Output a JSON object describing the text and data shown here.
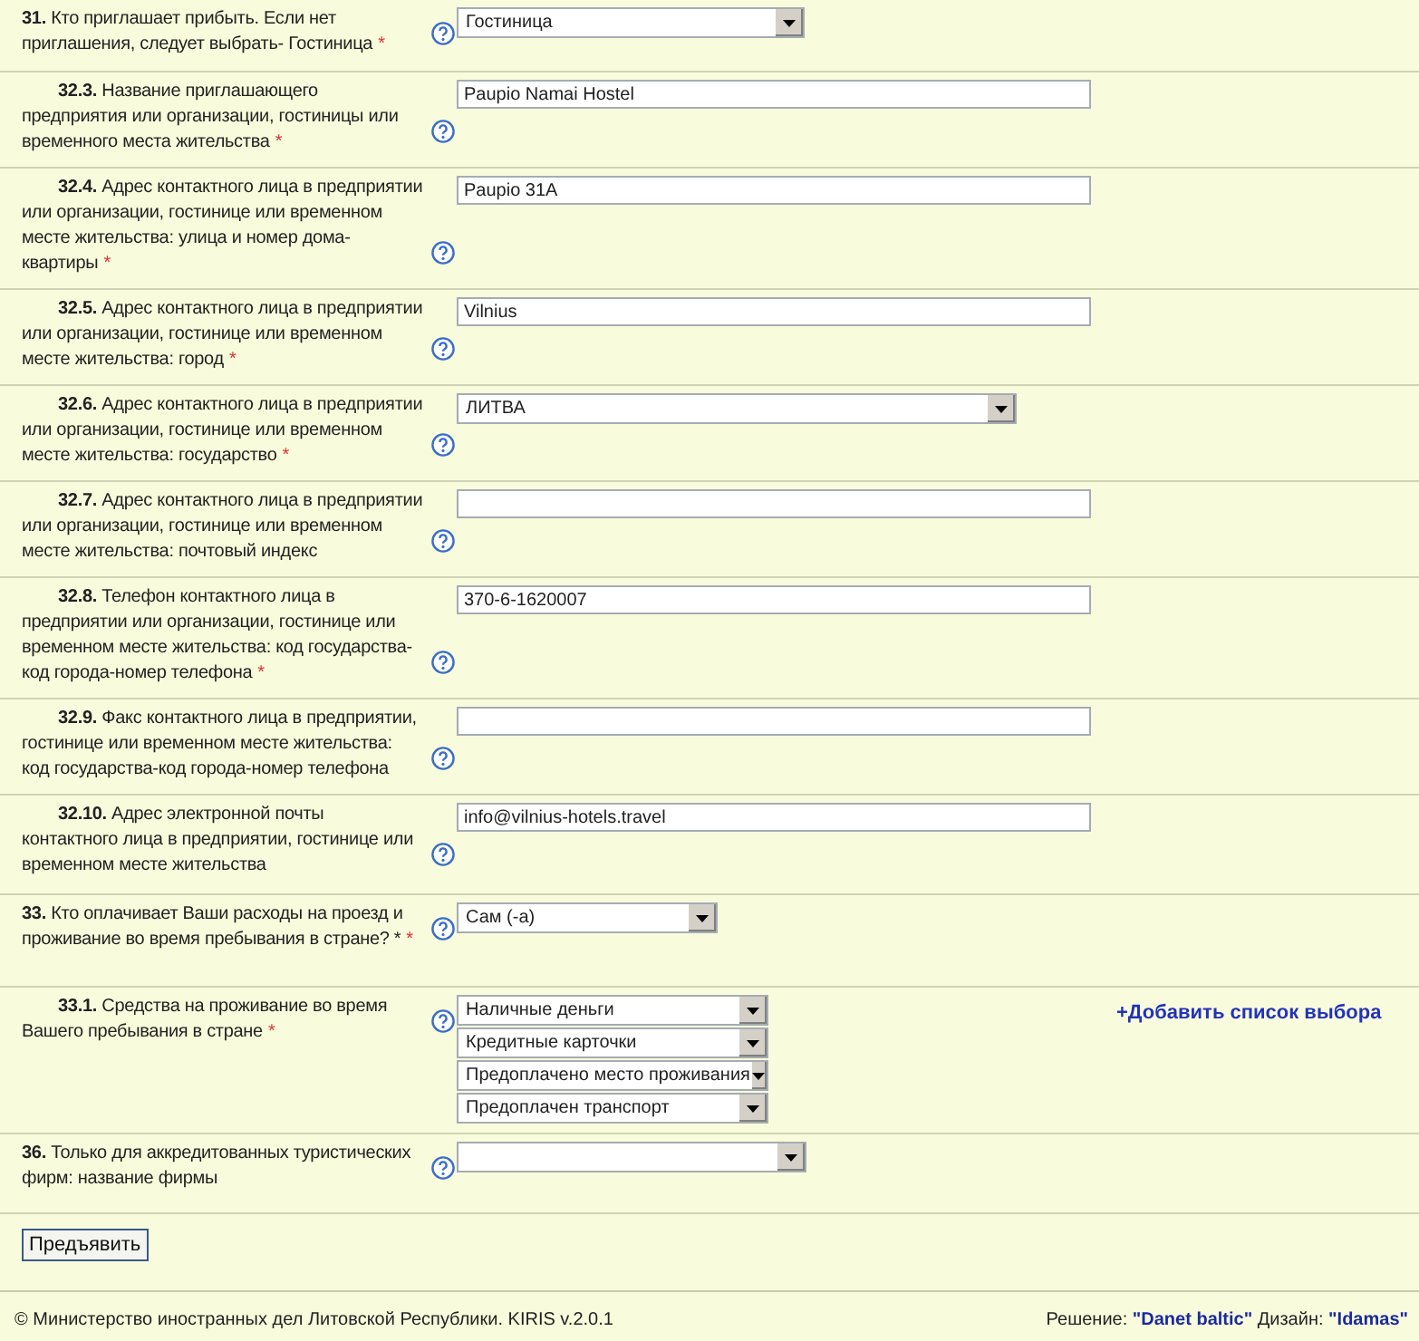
{
  "rows": [
    {
      "number": "31.",
      "text": "Кто приглашает прибыть. Если нет приглашения, следует выбрать- Гостиница",
      "required_mark": "*",
      "sub": false,
      "control": {
        "kind": "select",
        "value": "Гостиница"
      }
    },
    {
      "number": "32.3.",
      "text": "Название приглашающего предприятия или организации, гостиницы или временного места жительства",
      "required_mark": "*",
      "sub": true,
      "control": {
        "kind": "text",
        "value": "Paupio Namai Hostel"
      }
    },
    {
      "number": "32.4.",
      "text": "Адрес контактного лица в предприятии или организации, гостинице или временном месте жительства: улица и номер дома-квартиры",
      "required_mark": "*",
      "sub": true,
      "control": {
        "kind": "text",
        "value": "Paupio 31A"
      }
    },
    {
      "number": "32.5.",
      "text": "Адрес контактного лица в предприятии или организации, гостинице или временном месте жительства: город",
      "required_mark": "*",
      "sub": true,
      "control": {
        "kind": "text",
        "value": "Vilnius"
      }
    },
    {
      "number": "32.6.",
      "text": "Адрес контактного лица в предприятии или организации, гостинице или временном месте жительства: государство",
      "required_mark": "*",
      "sub": true,
      "control": {
        "kind": "select",
        "value": "ЛИТВА"
      }
    },
    {
      "number": "32.7.",
      "text": "Адрес контактного лица в предприятии или организации, гостинице или временном месте жительства: почтовый индекс",
      "sub": true,
      "control": {
        "kind": "text"
      }
    },
    {
      "number": "32.8.",
      "text": "Телефон контактного лица в предприятии или организации, гостинице или временном месте жительства: код государства-код города-номер телефона",
      "required_mark": "*",
      "sub": true,
      "control": {
        "kind": "text",
        "value": "370-6-1620007"
      }
    },
    {
      "number": "32.9.",
      "text": "Факс контактного лица в предприятии, гостинице или временном месте жительства: код государства-код города-номер телефона",
      "sub": true,
      "control": {
        "kind": "text"
      }
    },
    {
      "number": "32.10.",
      "text": "Адрес электронной почты контактного лица в предприятии, гостинице или временном месте жительства",
      "sub": true,
      "control": {
        "kind": "text",
        "value": "info@vilnius-hotels.travel"
      }
    },
    {
      "number": "33.",
      "text": "Кто оплачивает Ваши расходы на проезд и проживание во время пребывания в стране? *",
      "required_mark": "*",
      "sub": false,
      "control": {
        "kind": "select",
        "value": "Сам (-а)"
      }
    },
    {
      "number": "33.1.",
      "text": "Средства на проживание во время Вашего пребывания в стране",
      "required_mark": "*",
      "sub": true,
      "control": {
        "kind": "select_list",
        "values": [
          "Наличные деньги",
          "Кредитные карточки",
          "Предоплачено место проживания",
          "Предоплачен транспорт"
        ],
        "add_link": "+Добавить список выбора"
      }
    },
    {
      "number": "36.",
      "text": "Только для аккредитованных туристических фирм: название фирмы",
      "sub": false,
      "control": {
        "kind": "select"
      }
    }
  ],
  "submit": "Предъявить",
  "footer": {
    "copyright": "© Министерство иностранных дел Литовской Республики. KIRIS v.2.0.1",
    "credits": [
      {
        "label": "Решение:",
        "link": "\"Danet baltic\""
      },
      {
        "label": "Дизайн:",
        "link": "\"Idamas\""
      }
    ]
  }
}
